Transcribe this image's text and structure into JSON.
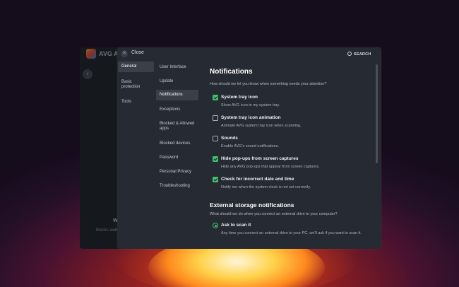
{
  "background_app": {
    "brand": "AVG",
    "partial_name": "Ant",
    "section_title_partial": "W",
    "section_text_partial": "Blocks web"
  },
  "modal": {
    "close_label": "Close",
    "search_label": "SEARCH",
    "nav_primary": [
      {
        "label": "General",
        "active": true
      },
      {
        "label": "Basic protection",
        "active": false
      },
      {
        "label": "Tools",
        "active": false
      }
    ],
    "nav_secondary": [
      {
        "label": "User Interface",
        "active": false
      },
      {
        "label": "Update",
        "active": false
      },
      {
        "label": "Notifications",
        "active": true
      },
      {
        "label": "Exceptions",
        "active": false
      },
      {
        "label": "Blocked & Allowed apps",
        "active": false
      },
      {
        "label": "Blocked devices",
        "active": false
      },
      {
        "label": "Password",
        "active": false
      },
      {
        "label": "Personal Privacy",
        "active": false
      },
      {
        "label": "Troubleshooting",
        "active": false
      }
    ],
    "notifications": {
      "title": "Notifications",
      "question": "How should we let you know when something needs your attention?",
      "options": [
        {
          "label": "System tray icon",
          "description": "Show AVG icon in my system tray.",
          "checked": true
        },
        {
          "label": "System tray icon animation",
          "description": "Animate AVG system tray icon when scanning.",
          "checked": false
        },
        {
          "label": "Sounds",
          "description": "Enable AVG's sound notifications.",
          "checked": false
        },
        {
          "label": "Hide pop-ups from screen captures",
          "description": "Hide any AVG pop-ups that appear from screen captures.",
          "checked": true
        },
        {
          "label": "Check for incorrect date and time",
          "description": "Notify me when the system clock is not set correctly.",
          "checked": true
        }
      ]
    },
    "external_storage": {
      "title": "External storage notifications",
      "question": "What should we do when you connect an external drive to your computer?",
      "options": [
        {
          "label": "Ask to scan it",
          "description": "Any time you connect an external drive to your PC, we'll ask if you want to scan it.",
          "selected": true
        }
      ]
    },
    "accent_color": "#3fbf6f"
  }
}
